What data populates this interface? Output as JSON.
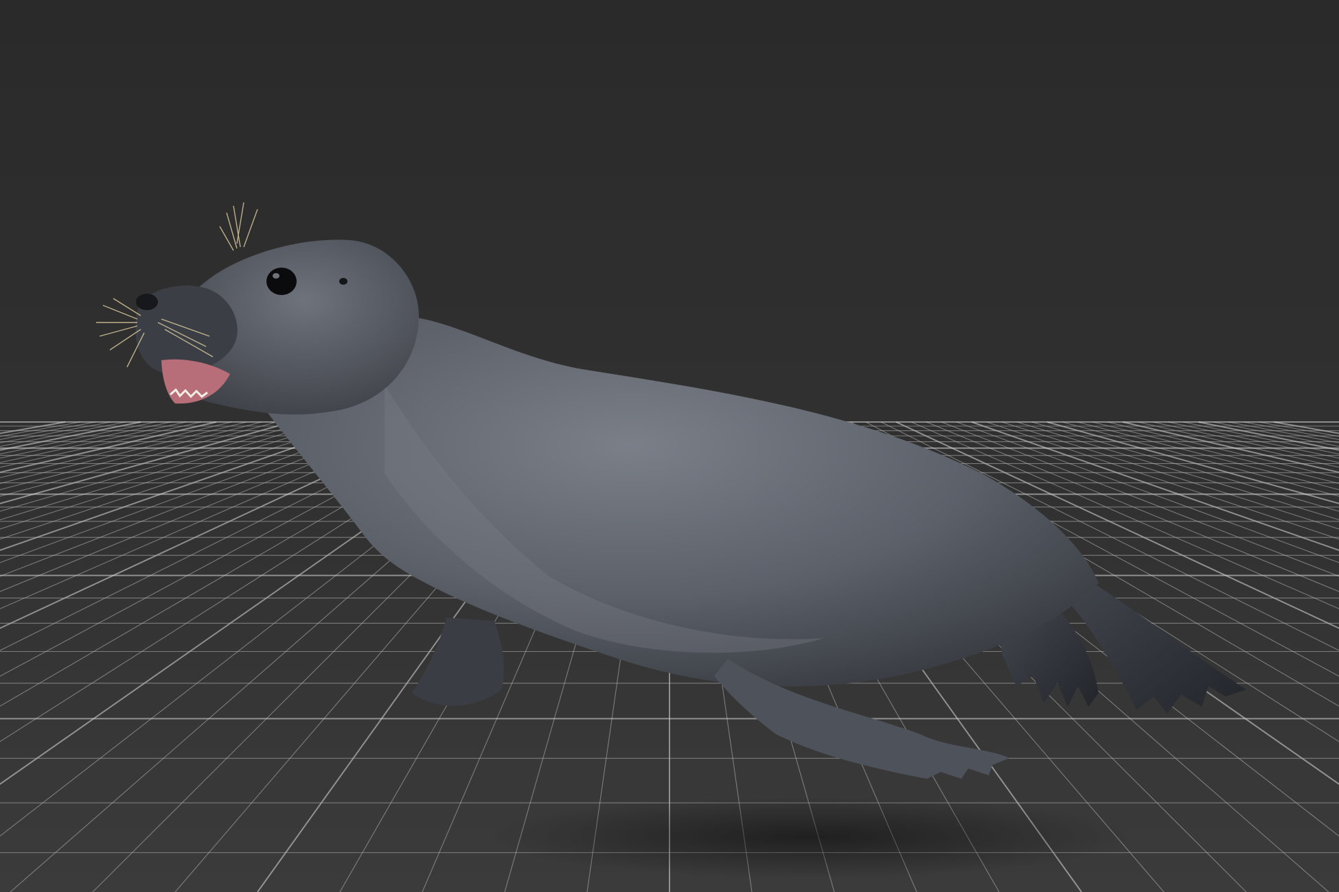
{
  "scene": {
    "background_color": "#2e2e2e",
    "grid_line_color": "#b8b8b8",
    "grid_major_line_color": "#dcdcdc",
    "floor_color": "#3a3a3a",
    "subject": "seal-3d-model",
    "subject_body_color": "#5a5e66",
    "subject_belly_color": "#7a7f86",
    "subject_flipper_color": "#2c2f35",
    "mouth_color": "#c9808a",
    "whisker_color": "#d8c89a"
  }
}
